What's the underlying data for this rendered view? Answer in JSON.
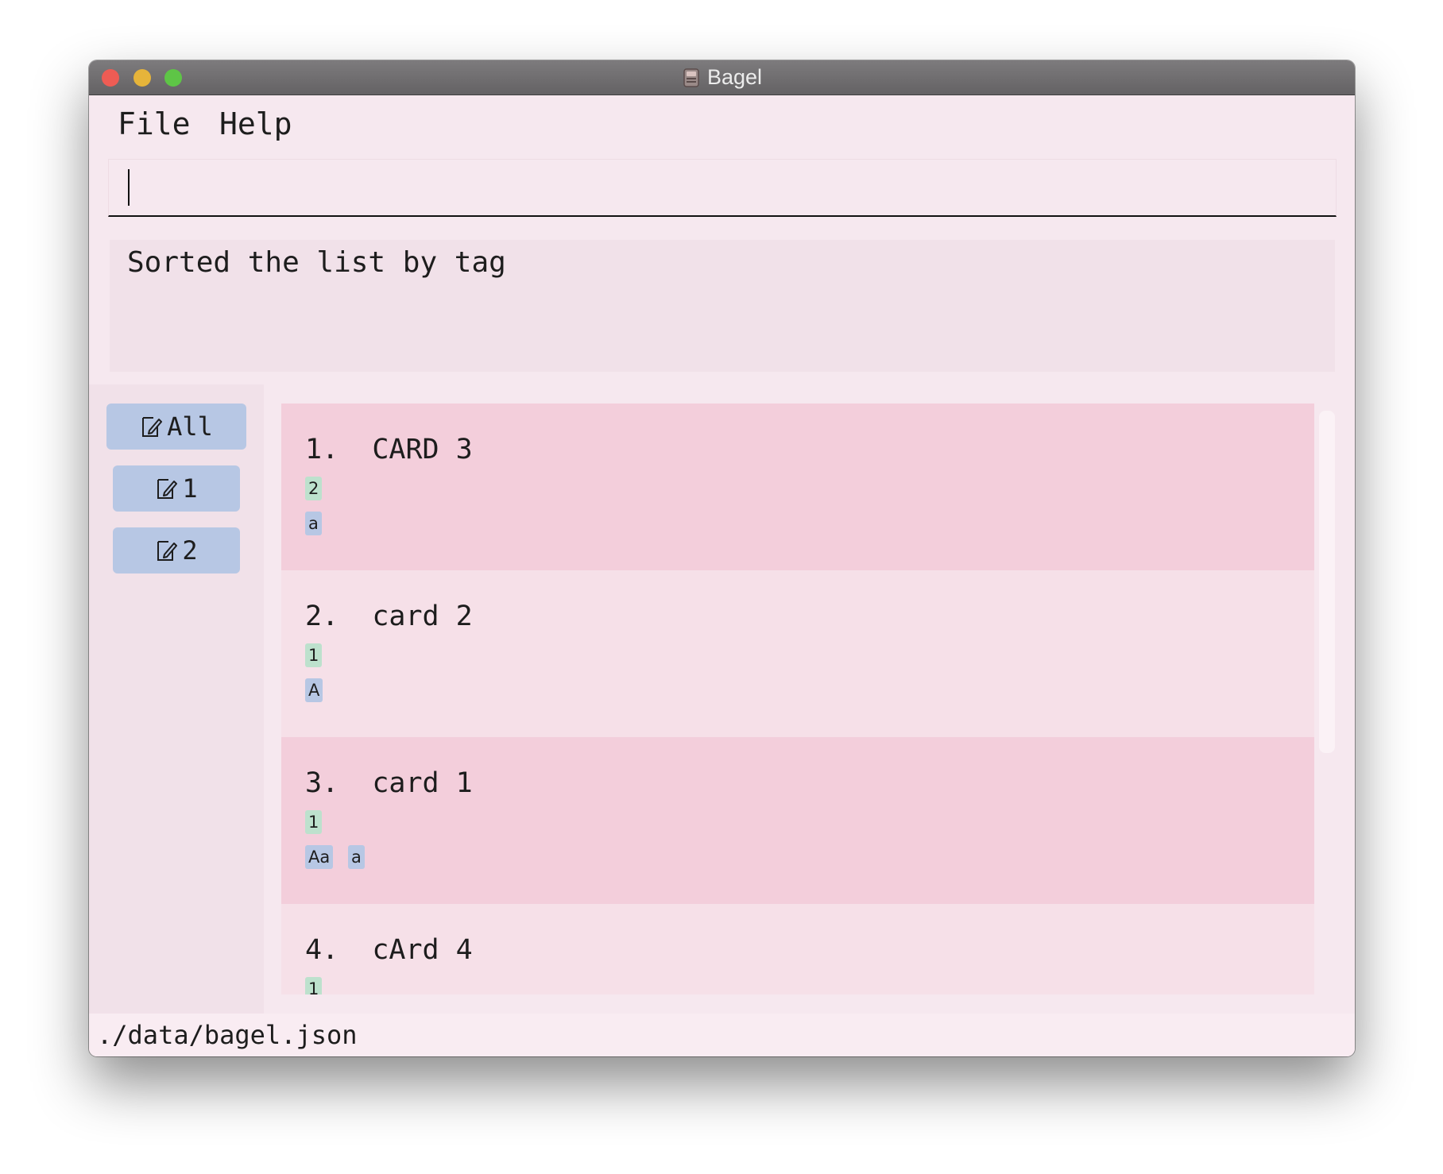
{
  "window": {
    "title": "Bagel"
  },
  "menu": {
    "file": "File",
    "help": "Help"
  },
  "command_box": {
    "value": ""
  },
  "result": {
    "text": "Sorted the list by tag"
  },
  "sidebar": {
    "items": [
      {
        "label": "All"
      },
      {
        "label": "1"
      },
      {
        "label": "2"
      }
    ]
  },
  "cards": [
    {
      "index": "1.",
      "title": "CARD 3",
      "number_tags": [
        "2"
      ],
      "tags": [
        "a"
      ]
    },
    {
      "index": "2.",
      "title": "card 2",
      "number_tags": [
        "1"
      ],
      "tags": [
        "A"
      ]
    },
    {
      "index": "3.",
      "title": "card 1",
      "number_tags": [
        "1"
      ],
      "tags": [
        "Aa",
        "a"
      ]
    },
    {
      "index": "4.",
      "title": "cArd 4",
      "number_tags": [
        "1"
      ],
      "tags": []
    }
  ],
  "status": {
    "file_path": "./data/bagel.json"
  },
  "colors": {
    "window_bg": "#f6e8ef",
    "card_odd": "#f3cedb",
    "card_even": "#f6e0e8",
    "button_blue": "#b7c7e4",
    "tag_green": "#bde1cd",
    "tag_blue": "#b7c7e4"
  },
  "icons": {
    "sidebar_item": "edit-note-icon",
    "app": "bagel-app-icon"
  }
}
